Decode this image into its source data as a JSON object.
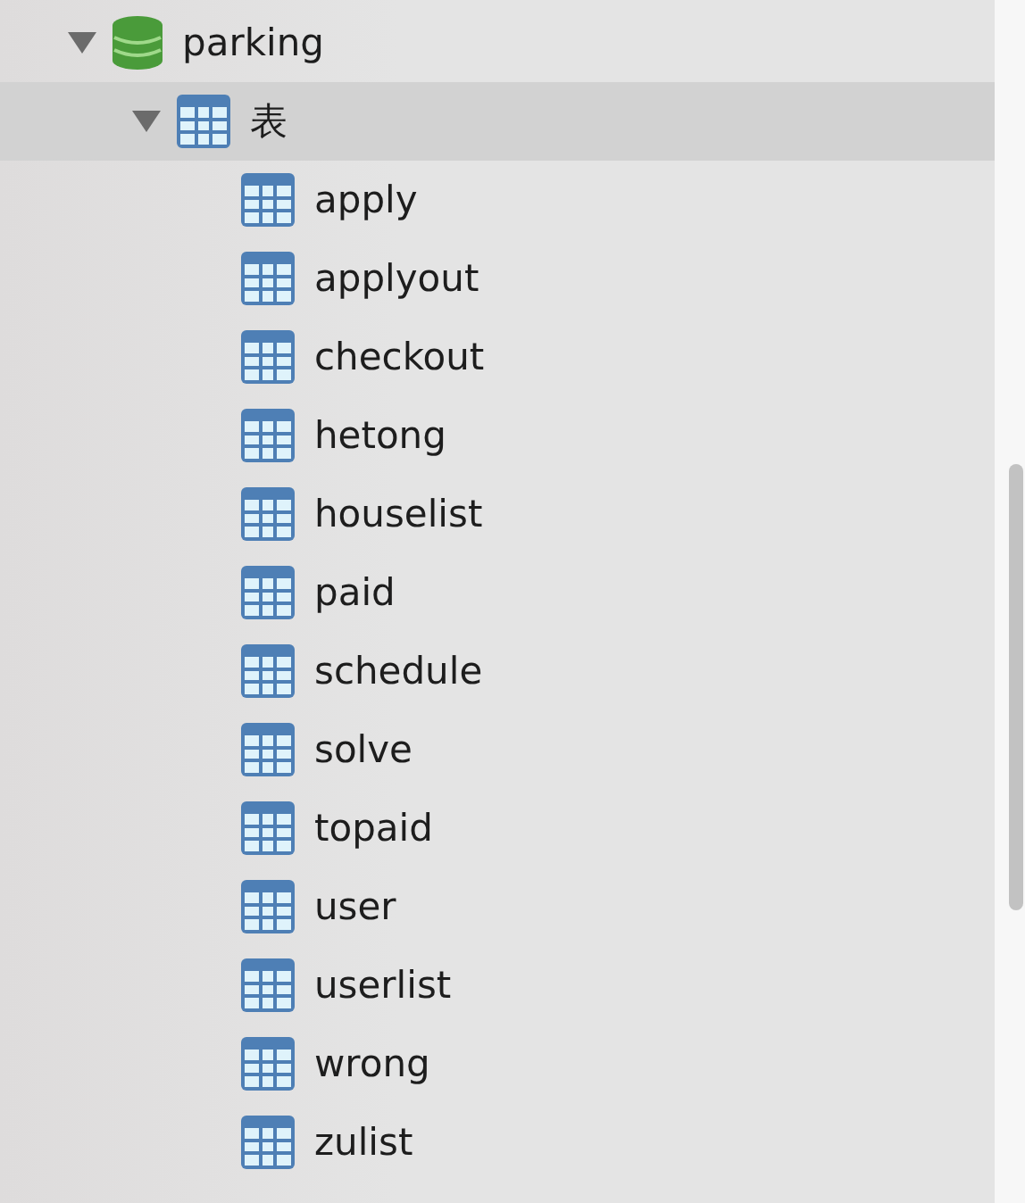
{
  "tree": [
    {
      "label": "parking",
      "kind": "database",
      "expanded": true,
      "selected": false,
      "children": [
        {
          "label": "表",
          "kind": "folder",
          "expanded": true,
          "selected": true,
          "children": [
            {
              "label": "apply",
              "kind": "table",
              "selected": false
            },
            {
              "label": "applyout",
              "kind": "table",
              "selected": false
            },
            {
              "label": "checkout",
              "kind": "table",
              "selected": false
            },
            {
              "label": "hetong",
              "kind": "table",
              "selected": false
            },
            {
              "label": "houselist",
              "kind": "table",
              "selected": false
            },
            {
              "label": "paid",
              "kind": "table",
              "selected": false
            },
            {
              "label": "schedule",
              "kind": "table",
              "selected": false
            },
            {
              "label": "solve",
              "kind": "table",
              "selected": false
            },
            {
              "label": "topaid",
              "kind": "table",
              "selected": false
            },
            {
              "label": "user",
              "kind": "table",
              "selected": false
            },
            {
              "label": "userlist",
              "kind": "table",
              "selected": false
            },
            {
              "label": "wrong",
              "kind": "table",
              "selected": false
            },
            {
              "label": "zulist",
              "kind": "table",
              "selected": false
            }
          ]
        }
      ]
    }
  ]
}
